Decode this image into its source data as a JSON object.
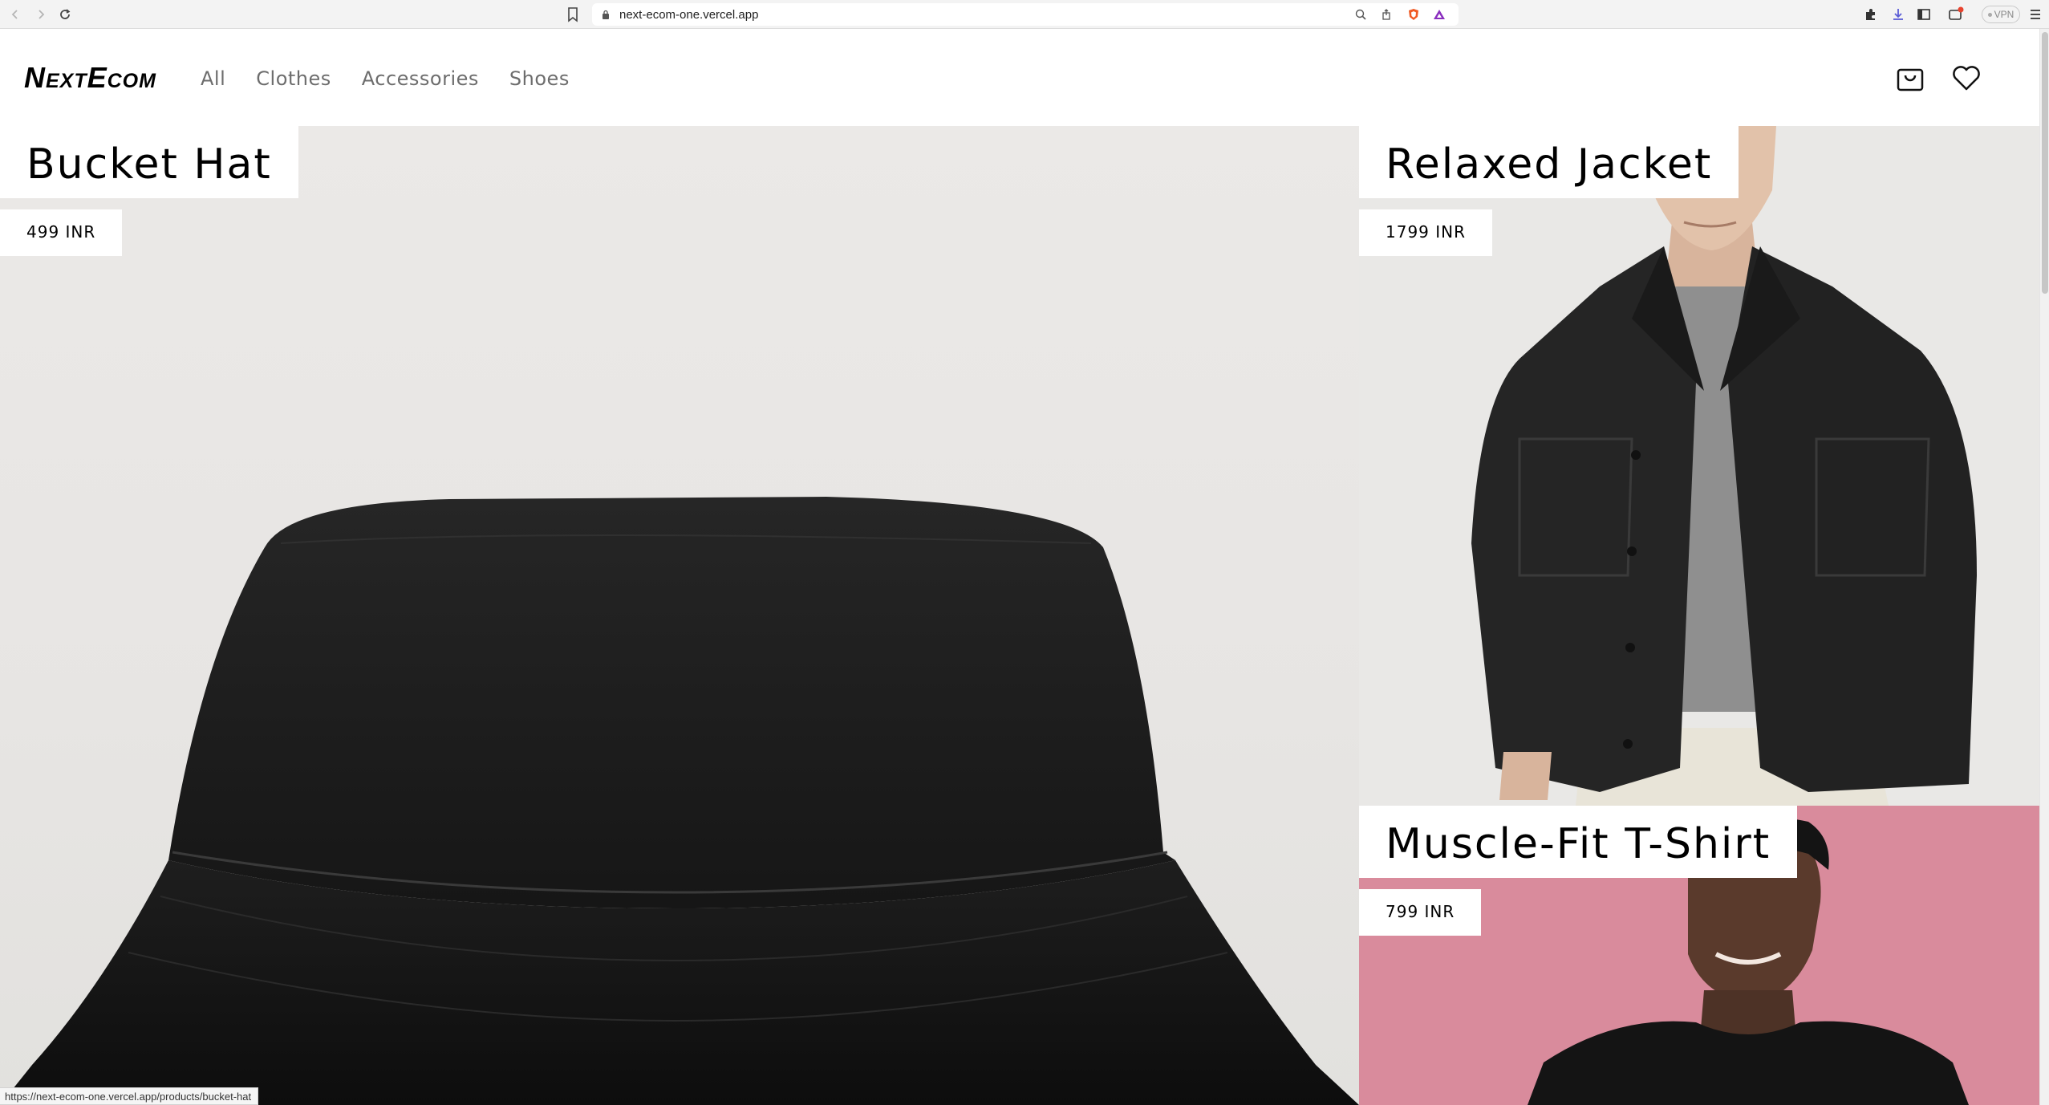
{
  "browser": {
    "url": "next-ecom-one.vercel.app",
    "vpn_label": "VPN",
    "status_url": "https://next-ecom-one.vercel.app/products/bucket-hat"
  },
  "header": {
    "logo": "NextEcom",
    "nav": [
      {
        "label": "All"
      },
      {
        "label": "Clothes"
      },
      {
        "label": "Accessories"
      },
      {
        "label": "Shoes"
      }
    ],
    "icons": [
      "cart-icon",
      "wishlist-heart-icon"
    ]
  },
  "products": [
    {
      "name": "Bucket Hat",
      "price": "499 INR"
    },
    {
      "name": "Relaxed Jacket",
      "price": "1799 INR"
    },
    {
      "name": "Muscle-Fit T-Shirt",
      "price": "799 INR"
    }
  ],
  "colors": {
    "nav_text": "#6d6d6d",
    "tee_background": "#d98b9c",
    "product_background": "#e9e8e6"
  }
}
